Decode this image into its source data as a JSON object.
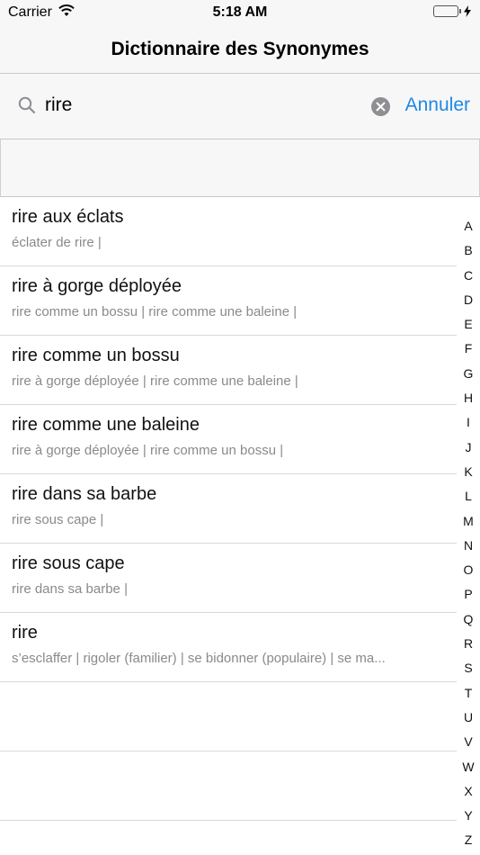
{
  "status": {
    "carrier": "Carrier",
    "time": "5:18 AM",
    "battery_level": 1.0,
    "icons": [
      "wifi-icon",
      "battery-icon",
      "charging-bolt-icon"
    ]
  },
  "nav": {
    "title": "Dictionnaire des Synonymes"
  },
  "search": {
    "query": "rire",
    "cancel_label": "Annuler",
    "icons": [
      "search-icon",
      "clear-icon"
    ]
  },
  "results": [
    {
      "title": "rire aux éclats",
      "subtitle": "éclater de rire |"
    },
    {
      "title": "rire à gorge déployée",
      "subtitle": "rire comme un bossu | rire comme une baleine |"
    },
    {
      "title": "rire comme un bossu",
      "subtitle": "rire à gorge déployée | rire comme une baleine |"
    },
    {
      "title": "rire comme une baleine",
      "subtitle": "rire à gorge déployée | rire comme un bossu |"
    },
    {
      "title": "rire dans sa barbe",
      "subtitle": "rire sous cape |"
    },
    {
      "title": "rire sous cape",
      "subtitle": "rire dans sa barbe |"
    },
    {
      "title": "rire",
      "subtitle": "s’esclaffer | rigoler (familier) | se bidonner (populaire) | se ma..."
    },
    {
      "title": "",
      "subtitle": ""
    },
    {
      "title": "",
      "subtitle": ""
    }
  ],
  "index_letters": [
    "A",
    "B",
    "C",
    "D",
    "E",
    "F",
    "G",
    "H",
    "I",
    "J",
    "K",
    "L",
    "M",
    "N",
    "O",
    "P",
    "Q",
    "R",
    "S",
    "T",
    "U",
    "V",
    "W",
    "X",
    "Y",
    "Z"
  ],
  "colors": {
    "accent": "#1e88e5",
    "battery": "#4cd964",
    "bar_background": "#f7f7f7",
    "subtitle": "#8a8a8a"
  }
}
